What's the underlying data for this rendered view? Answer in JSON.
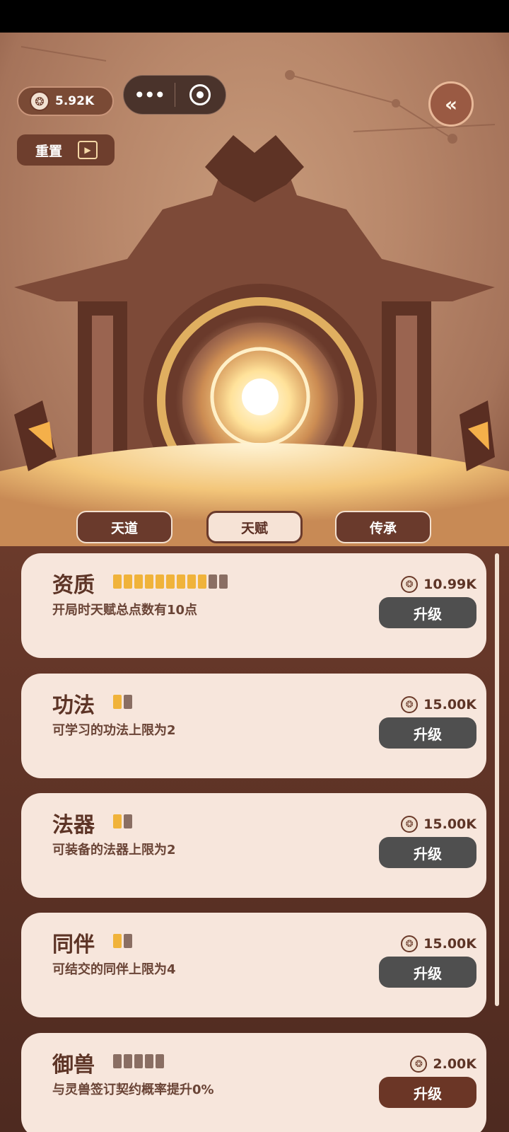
{
  "header": {
    "currency_value": "5.92K",
    "reset_label": "重置"
  },
  "tabs": [
    {
      "label": "天道",
      "active": false
    },
    {
      "label": "天赋",
      "active": true
    },
    {
      "label": "传承",
      "active": false
    }
  ],
  "talents": [
    {
      "title": "资质",
      "pips_on": 9,
      "pips_total": 11,
      "description": "开局时天赋总点数有10点",
      "cost": "10.99K",
      "button": "升级",
      "enabled": false
    },
    {
      "title": "功法",
      "pips_on": 1,
      "pips_total": 2,
      "description": "可学习的功法上限为2",
      "cost": "15.00K",
      "button": "升级",
      "enabled": false
    },
    {
      "title": "法器",
      "pips_on": 1,
      "pips_total": 2,
      "description": "可装备的法器上限为2",
      "cost": "15.00K",
      "button": "升级",
      "enabled": false
    },
    {
      "title": "同伴",
      "pips_on": 1,
      "pips_total": 2,
      "description": "可结交的同伴上限为4",
      "cost": "15.00K",
      "button": "升级",
      "enabled": false
    },
    {
      "title": "御兽",
      "pips_on": 0,
      "pips_total": 5,
      "description": "与灵兽签订契约概率提升0%",
      "cost": "2.00K",
      "button": "升级",
      "enabled": true
    }
  ],
  "colors": {
    "pip_on": "#f0b33b",
    "pip_off": "#8a6e63",
    "button_disabled": "#4f4f4f",
    "button_enabled": "#6b3626"
  }
}
